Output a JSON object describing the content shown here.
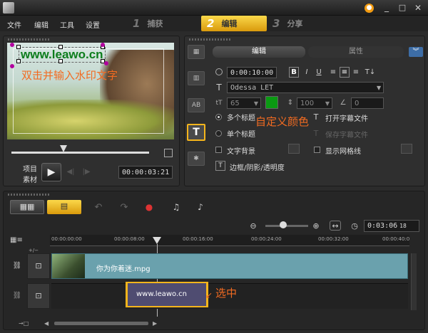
{
  "menu": [
    "文件",
    "编辑",
    "工具",
    "设置"
  ],
  "steps": [
    {
      "num": "1",
      "label": "捕获"
    },
    {
      "num": "2",
      "label": "编辑"
    },
    {
      "num": "3",
      "label": "分享"
    }
  ],
  "watermark_text": "www.leawo.cn",
  "annotation_dblclick": "双击并输入水印文字",
  "annotation_color": "自定义颜色",
  "annotation_select": "选中",
  "player": {
    "project_label": "项目",
    "clip_label": "素材",
    "timecode": "00:00:03:21"
  },
  "tabs": {
    "edit": "编辑",
    "props": "属性"
  },
  "options": {
    "duration": "0:00:10:00",
    "font": "Odessa LET",
    "font_size": "65",
    "line_spacing": "100",
    "angle": "0",
    "multi_title": "多个标题",
    "single_title": "单个标题",
    "open_subtitle": "打开字幕文件",
    "save_subtitle": "保存字幕文件",
    "text_bg": "文字背景",
    "show_grid": "显示网格线",
    "border_shadow": "边框/阴影/透明度"
  },
  "colors": {
    "font_color": "#0a9a12",
    "accent": "#f5b51c"
  },
  "timeline": {
    "total_time": "0:03:06",
    "total_frames": "18",
    "ruler": [
      "00:00:00:00",
      "00:00:08:00",
      "00:00:16:00",
      "00:00:24:00",
      "00:00:32:00",
      "00:00:40:0"
    ],
    "video_clip": "你为你着迷.mpg",
    "title_clip": "www.leawo.cn"
  }
}
